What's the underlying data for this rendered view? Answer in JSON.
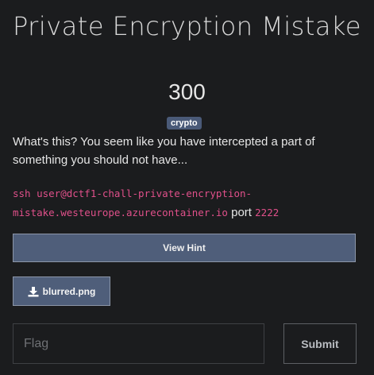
{
  "challenge": {
    "title": "Private Encryption Mistake",
    "points": "300",
    "category": "crypto",
    "description": "What's this? You seem like you have intercepted a part of something you should not have...",
    "command": "ssh user@dctf1-chall-private-encryption-mistake.westeurope.azurecontainer.io",
    "port_word": "port",
    "port": "2222"
  },
  "actions": {
    "hint_label": "View Hint",
    "file_label": "blurred.png",
    "file_icon": "download-icon"
  },
  "flag": {
    "placeholder": "Flag",
    "value": "",
    "submit_label": "Submit"
  },
  "colors": {
    "background": "#1b1c1e",
    "button": "#4f5e7a",
    "badge": "#4a5a78",
    "code": "#e0508a"
  }
}
